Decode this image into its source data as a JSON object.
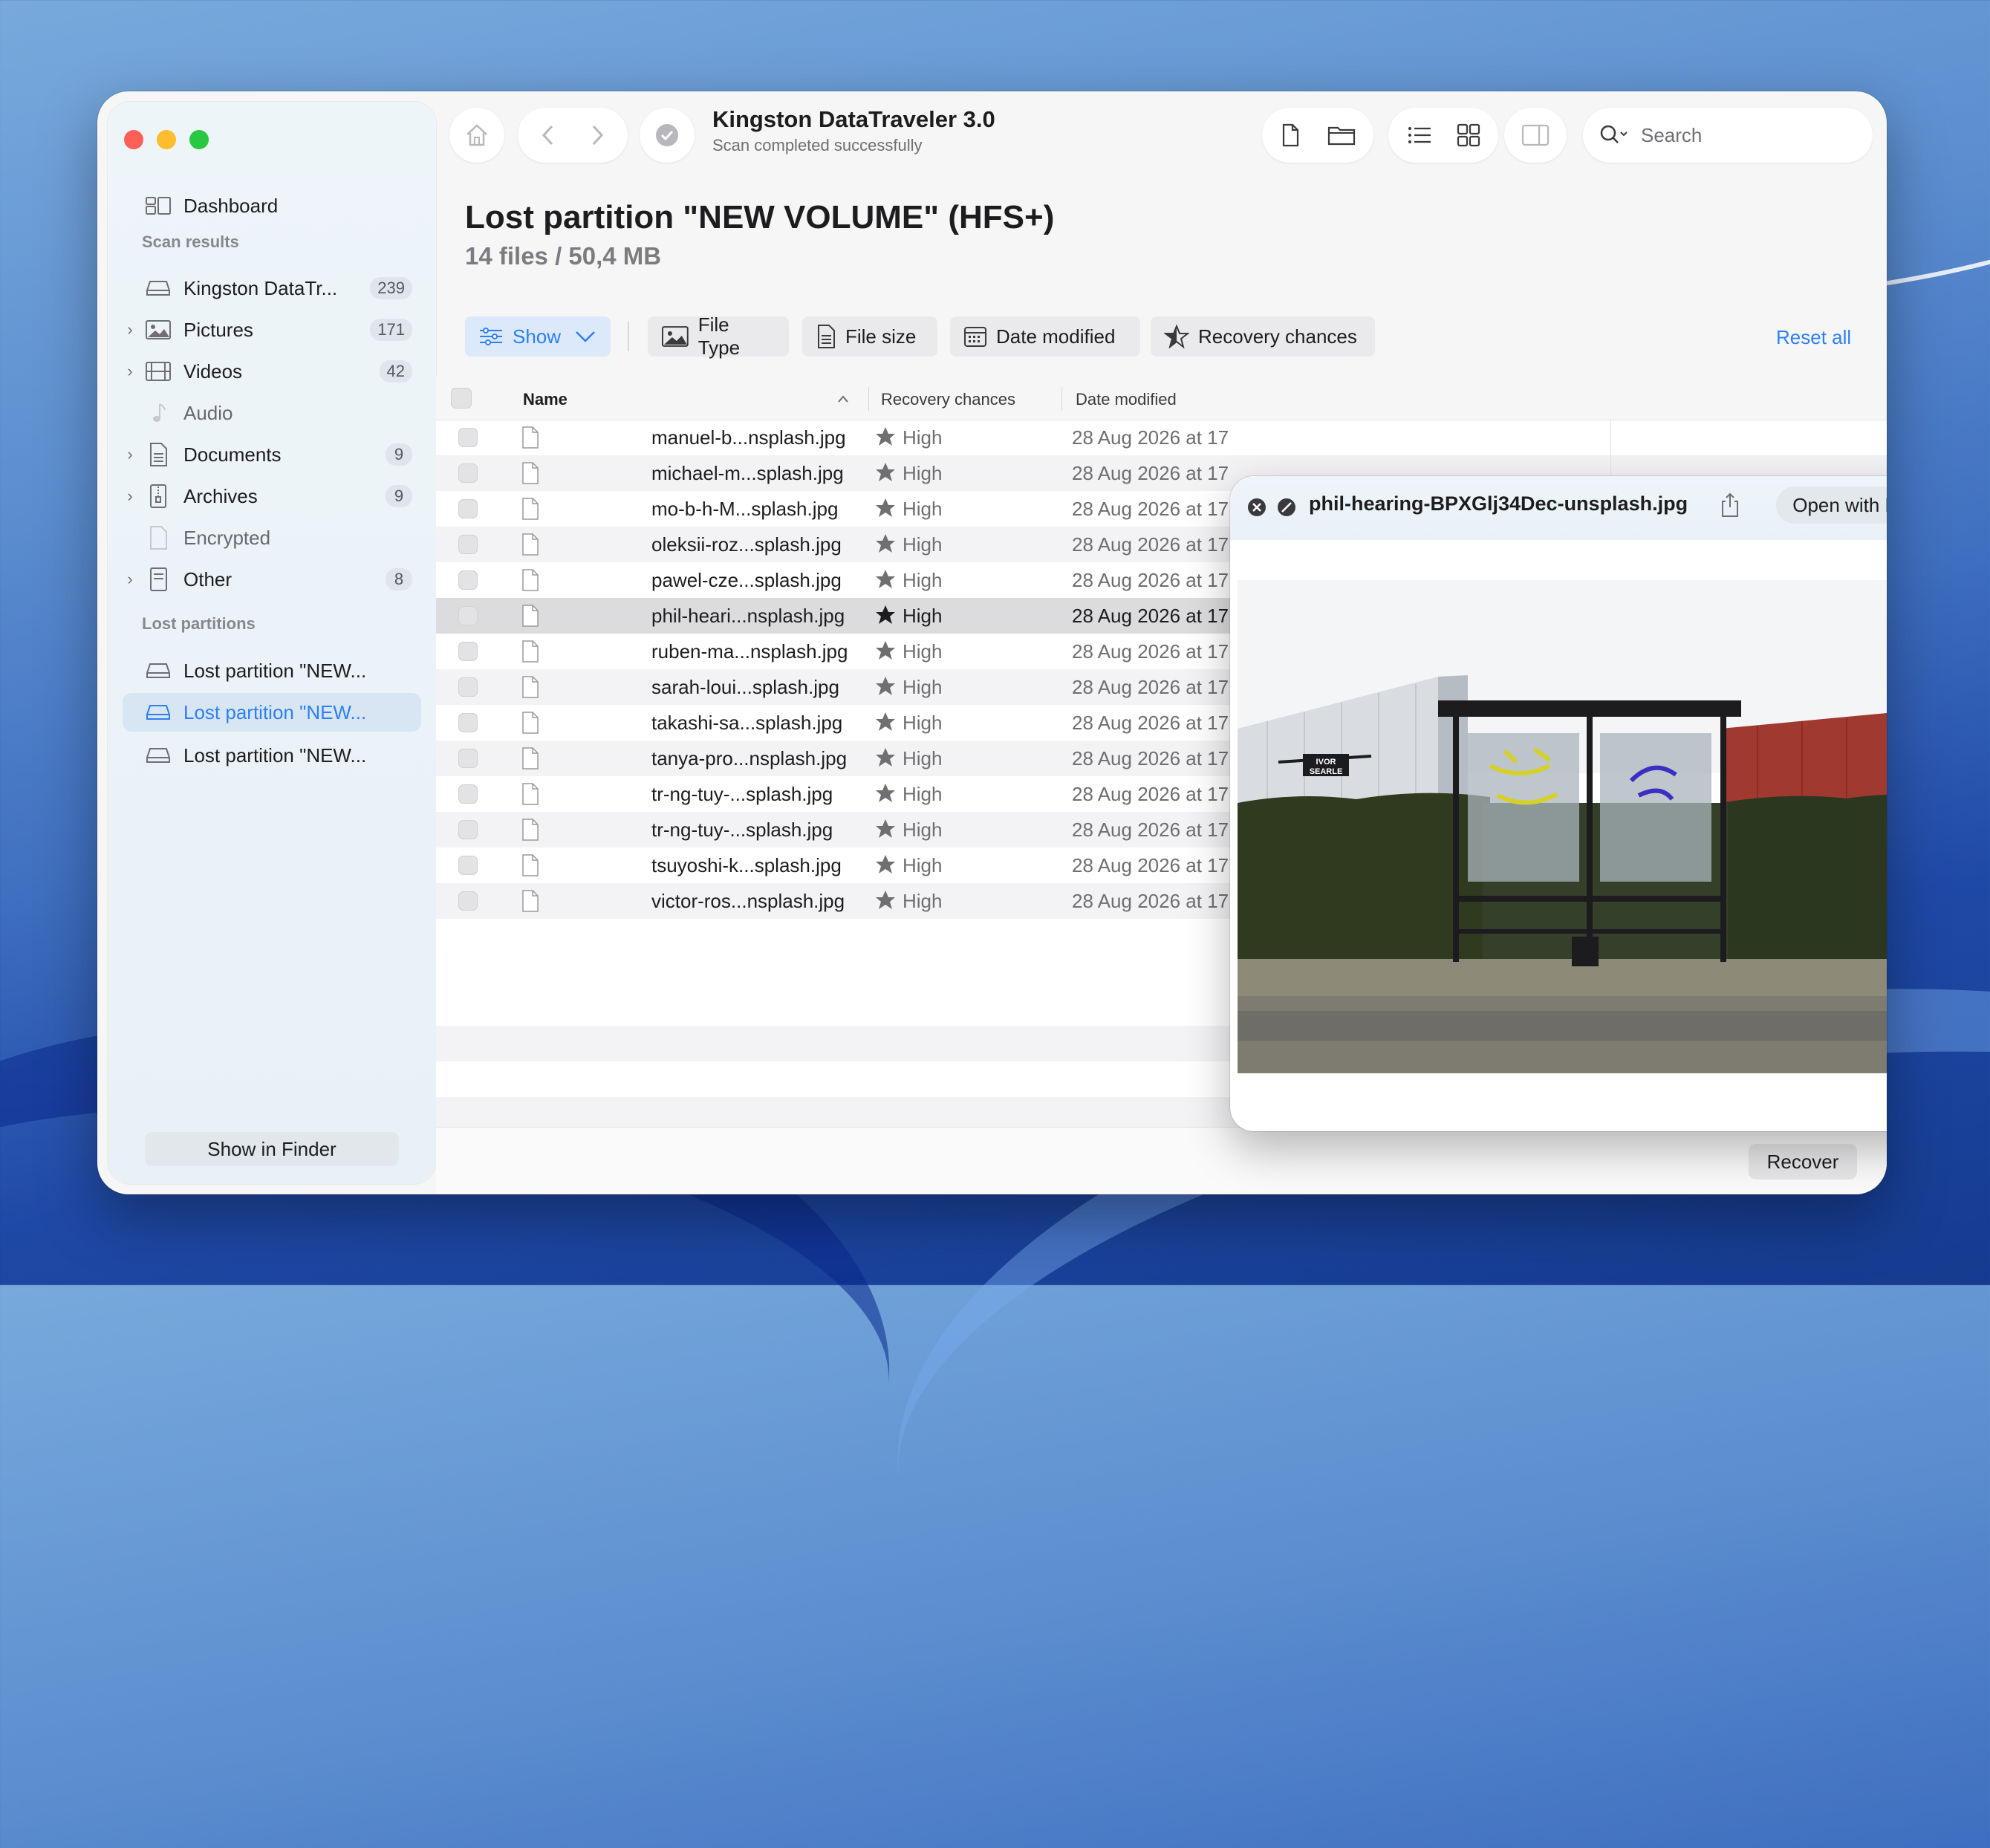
{
  "window": {
    "title": "Kingston DataTraveler 3.0",
    "subtitle": "Scan completed successfully"
  },
  "sidebar": {
    "dashboard": "Dashboard",
    "scan_results_header": "Scan results",
    "scan_items": [
      {
        "label": "Kingston DataTr...",
        "count": "239",
        "icon": "drive-icon"
      },
      {
        "label": "Pictures",
        "count": "171",
        "icon": "picture-icon"
      },
      {
        "label": "Videos",
        "count": "42",
        "icon": "film-icon"
      },
      {
        "label": "Audio",
        "count": "",
        "icon": "music-note-icon"
      },
      {
        "label": "Documents",
        "count": "9",
        "icon": "document-icon"
      },
      {
        "label": "Archives",
        "count": "9",
        "icon": "archive-icon"
      },
      {
        "label": "Encrypted",
        "count": "",
        "icon": "encrypted-icon"
      },
      {
        "label": "Other",
        "count": "8",
        "icon": "other-file-icon"
      }
    ],
    "lost_partitions_header": "Lost partitions",
    "lost_partitions": [
      {
        "label": "Lost partition \"NEW..."
      },
      {
        "label": "Lost partition \"NEW..."
      },
      {
        "label": "Lost partition \"NEW..."
      }
    ],
    "show_in_finder": "Show in Finder"
  },
  "search": {
    "placeholder": "Search"
  },
  "heading": {
    "title": "Lost partition \"NEW VOLUME\" (HFS+)",
    "summary": "14 files / 50,4 MB"
  },
  "filters": {
    "show": "Show",
    "file_type": "File Type",
    "file_size": "File size",
    "date_modified": "Date modified",
    "recovery_chances": "Recovery chances",
    "reset_all": "Reset all"
  },
  "table": {
    "columns": [
      "Name",
      "Recovery chances",
      "Date modified"
    ],
    "rows": [
      {
        "name": "manuel-b...nsplash.jpg",
        "chance": "High",
        "date": "28 Aug 2026 at 17"
      },
      {
        "name": "michael-m...splash.jpg",
        "chance": "High",
        "date": "28 Aug 2026 at 17"
      },
      {
        "name": "mo-b-h-M...splash.jpg",
        "chance": "High",
        "date": "28 Aug 2026 at 17"
      },
      {
        "name": "oleksii-roz...splash.jpg",
        "chance": "High",
        "date": "28 Aug 2026 at 17"
      },
      {
        "name": "pawel-cze...splash.jpg",
        "chance": "High",
        "date": "28 Aug 2026 at 17"
      },
      {
        "name": "phil-heari...nsplash.jpg",
        "chance": "High",
        "date": "28 Aug 2026 at 17"
      },
      {
        "name": "ruben-ma...nsplash.jpg",
        "chance": "High",
        "date": "28 Aug 2026 at 17"
      },
      {
        "name": "sarah-loui...splash.jpg",
        "chance": "High",
        "date": "28 Aug 2026 at 17"
      },
      {
        "name": "takashi-sa...splash.jpg",
        "chance": "High",
        "date": "28 Aug 2026 at 17"
      },
      {
        "name": "tanya-pro...nsplash.jpg",
        "chance": "High",
        "date": "28 Aug 2026 at 17"
      },
      {
        "name": "tr-ng-tuy-...splash.jpg",
        "chance": "High",
        "date": "28 Aug 2026 at 17"
      },
      {
        "name": "tr-ng-tuy-...splash.jpg",
        "chance": "High",
        "date": "28 Aug 2026 at 17"
      },
      {
        "name": "tsuyoshi-k...splash.jpg",
        "chance": "High",
        "date": "28 Aug 2026 at 17"
      },
      {
        "name": "victor-ros...nsplash.jpg",
        "chance": "High",
        "date": "28 Aug 2026 at 17"
      }
    ]
  },
  "preview": {
    "filename": "phil-hearing-BPXGlj34Dec-unsplash.jpg",
    "open_with": "Open with Preview",
    "sign_line1": "IVOR",
    "sign_line2": "SEARLE"
  },
  "footer": {
    "recover": "Recover"
  }
}
